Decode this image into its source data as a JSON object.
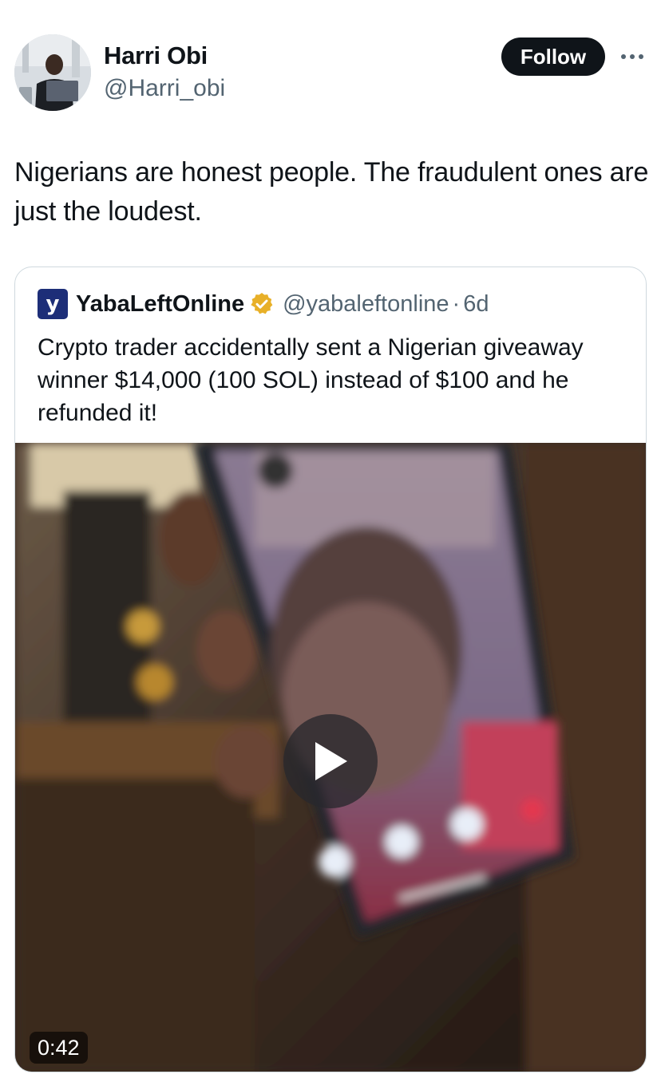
{
  "author": {
    "name": "Harri Obi",
    "handle": "@Harri_obi",
    "avatar_icon": "profile-photo"
  },
  "actions": {
    "follow_label": "Follow",
    "more_icon": "more-dots-icon"
  },
  "tweet": {
    "text": "Nigerians are honest people. The fraudulent ones are just the loudest."
  },
  "quoted_tweet": {
    "logo_letter": "y",
    "name": "YabaLeftOnline",
    "verified_icon": "gold-verified-badge",
    "handle": "@yabaleftonline",
    "separator": "·",
    "time": "6d",
    "text": "Crypto trader accidentally sent a Nigerian giveaway winner $14,000 (100 SOL) instead of $100 and he refunded it!",
    "video": {
      "duration": "0:42",
      "play_icon": "play-icon"
    }
  },
  "colors": {
    "text_primary": "#0f1419",
    "text_secondary": "#536471",
    "border": "#cfd9de",
    "follow_bg": "#0f1419",
    "verified_gold": "#e8b028",
    "logo_bg": "#1d2e78"
  }
}
